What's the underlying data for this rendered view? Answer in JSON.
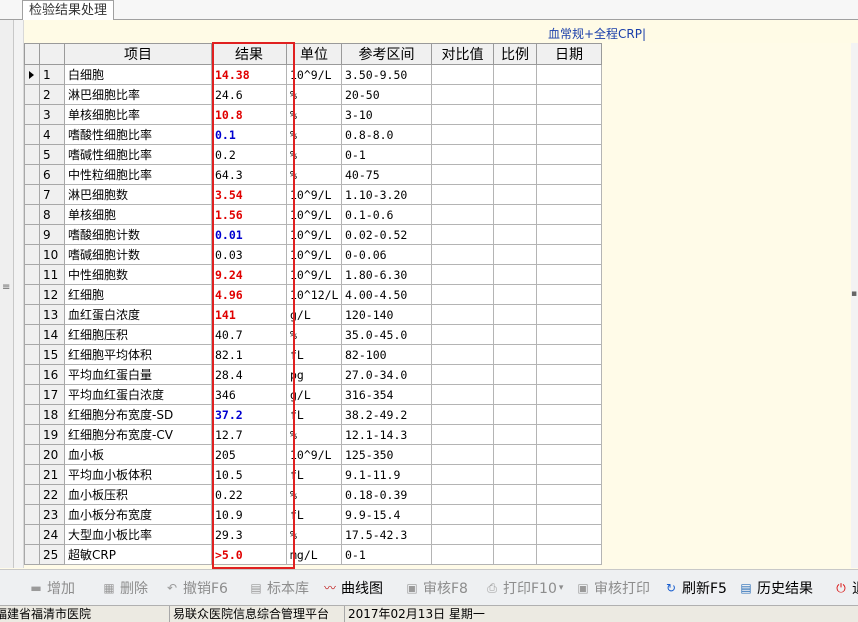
{
  "tab": {
    "label": "检验结果处理"
  },
  "report": {
    "title": "血常规+全程CRP|"
  },
  "table": {
    "headers": {
      "item": "项目",
      "result": "结果",
      "unit": "单位",
      "reference": "参考区间",
      "compare": "对比值",
      "ratio": "比例",
      "date": "日期"
    },
    "rows": [
      {
        "no": "1",
        "name": "白细胞",
        "result": "14.38",
        "flag": "high",
        "unit": "10^9/L",
        "ref": "3.50-9.50"
      },
      {
        "no": "2",
        "name": "淋巴细胞比率",
        "result": "24.6",
        "flag": "",
        "unit": "%",
        "ref": "20-50"
      },
      {
        "no": "3",
        "name": "单核细胞比率",
        "result": "10.8",
        "flag": "high",
        "unit": "%",
        "ref": "3-10"
      },
      {
        "no": "4",
        "name": "嗜酸性细胞比率",
        "result": "0.1",
        "flag": "low",
        "unit": "%",
        "ref": "0.8-8.0"
      },
      {
        "no": "5",
        "name": "嗜碱性细胞比率",
        "result": "0.2",
        "flag": "",
        "unit": "%",
        "ref": "0-1"
      },
      {
        "no": "6",
        "name": "中性粒细胞比率",
        "result": "64.3",
        "flag": "",
        "unit": "%",
        "ref": "40-75"
      },
      {
        "no": "7",
        "name": "淋巴细胞数",
        "result": "3.54",
        "flag": "high",
        "unit": "10^9/L",
        "ref": "1.10-3.20"
      },
      {
        "no": "8",
        "name": "单核细胞",
        "result": "1.56",
        "flag": "high",
        "unit": "10^9/L",
        "ref": "0.1-0.6"
      },
      {
        "no": "9",
        "name": "嗜酸细胞计数",
        "result": "0.01",
        "flag": "low",
        "unit": "10^9/L",
        "ref": "0.02-0.52"
      },
      {
        "no": "10",
        "name": "嗜碱细胞计数",
        "result": "0.03",
        "flag": "",
        "unit": "10^9/L",
        "ref": "0-0.06"
      },
      {
        "no": "11",
        "name": "中性细胞数",
        "result": "9.24",
        "flag": "high",
        "unit": "10^9/L",
        "ref": "1.80-6.30"
      },
      {
        "no": "12",
        "name": "红细胞",
        "result": "4.96",
        "flag": "high",
        "unit": "10^12/L",
        "ref": "4.00-4.50"
      },
      {
        "no": "13",
        "name": "血红蛋白浓度",
        "result": "141",
        "flag": "high",
        "unit": "g/L",
        "ref": "120-140"
      },
      {
        "no": "14",
        "name": "红细胞压积",
        "result": "40.7",
        "flag": "",
        "unit": "%",
        "ref": "35.0-45.0"
      },
      {
        "no": "15",
        "name": "红细胞平均体积",
        "result": "82.1",
        "flag": "",
        "unit": "fL",
        "ref": "82-100"
      },
      {
        "no": "16",
        "name": "平均血红蛋白量",
        "result": "28.4",
        "flag": "",
        "unit": "pg",
        "ref": "27.0-34.0"
      },
      {
        "no": "17",
        "name": "平均血红蛋白浓度",
        "result": "346",
        "flag": "",
        "unit": "g/L",
        "ref": "316-354"
      },
      {
        "no": "18",
        "name": "红细胞分布宽度-SD",
        "result": "37.2",
        "flag": "low",
        "unit": "fL",
        "ref": "38.2-49.2"
      },
      {
        "no": "19",
        "name": "红细胞分布宽度-CV",
        "result": "12.7",
        "flag": "",
        "unit": "%",
        "ref": "12.1-14.3"
      },
      {
        "no": "20",
        "name": "血小板",
        "result": "205",
        "flag": "",
        "unit": "10^9/L",
        "ref": "125-350"
      },
      {
        "no": "21",
        "name": "平均血小板体积",
        "result": "10.5",
        "flag": "",
        "unit": "fL",
        "ref": "9.1-11.9"
      },
      {
        "no": "22",
        "name": "血小板压积",
        "result": "0.22",
        "flag": "",
        "unit": "%",
        "ref": "0.18-0.39"
      },
      {
        "no": "23",
        "name": "血小板分布宽度",
        "result": "10.9",
        "flag": "",
        "unit": "fL",
        "ref": "9.9-15.4"
      },
      {
        "no": "24",
        "name": "大型血小板比率",
        "result": "29.3",
        "flag": "",
        "unit": "%",
        "ref": "17.5-42.3"
      },
      {
        "no": "25",
        "name": "超敏CRP",
        "result": ">5.0",
        "flag": "high",
        "unit": "mg/L",
        "ref": "0-1"
      }
    ]
  },
  "toolbar": {
    "buttons": [
      {
        "id": "add",
        "label": "增加",
        "icon": "add-icon",
        "enabled": false
      },
      {
        "id": "delete",
        "label": "删除",
        "icon": "delete-icon",
        "enabled": false
      },
      {
        "id": "undo",
        "label": "撤销F6",
        "icon": "undo-icon",
        "enabled": false
      },
      {
        "id": "template",
        "label": "标本库",
        "icon": "document-icon",
        "enabled": false
      },
      {
        "id": "curve",
        "label": "曲线图",
        "icon": "line-chart-icon",
        "enabled": true
      },
      {
        "id": "audit",
        "label": "审核F8",
        "icon": "audit-icon",
        "enabled": false
      },
      {
        "id": "print",
        "label": "打印F10",
        "icon": "printer-icon",
        "enabled": false
      },
      {
        "id": "audit-print",
        "label": "审核打印",
        "icon": "audit-print-icon",
        "enabled": false
      },
      {
        "id": "refresh",
        "label": "刷新F5",
        "icon": "refresh-icon",
        "enabled": true
      },
      {
        "id": "history",
        "label": "历史结果",
        "icon": "history-icon",
        "enabled": true
      },
      {
        "id": "exit",
        "label": "退",
        "icon": "power-icon",
        "enabled": true
      }
    ]
  },
  "status": {
    "hospital": "福建省福清市医院",
    "platform": "易联众医院信息综合管理平台",
    "date": "2017年02月13日  星期一"
  },
  "colors": {
    "high": "#e00000",
    "low": "#0000d0",
    "highlight_box": "#e02020",
    "report_title": "#1a3faa"
  }
}
